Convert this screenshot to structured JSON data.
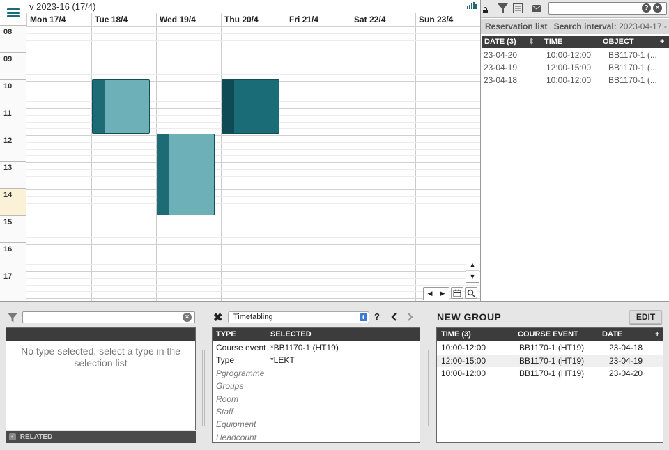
{
  "calendar": {
    "week_title": "v 2023-16 (17/4)",
    "days": [
      "Mon 17/4",
      "Tue 18/4",
      "Wed 19/4",
      "Thu 20/4",
      "Fri 21/4",
      "Sat 22/4",
      "Sun 23/4"
    ],
    "hours": [
      "08",
      "09",
      "10",
      "11",
      "12",
      "13",
      "14",
      "15",
      "16",
      "17"
    ],
    "highlight_hour": "14",
    "events": [
      {
        "day": 1,
        "start": 10,
        "end": 12,
        "style": "light"
      },
      {
        "day": 2,
        "start": 12,
        "end": 15,
        "style": "light"
      },
      {
        "day": 3,
        "start": 10,
        "end": 12,
        "style": "dark"
      }
    ],
    "colors": {
      "event_light": "#6db0b8",
      "event_dark": "#1a6c76",
      "accent": "#1e6b78"
    }
  },
  "right_panel": {
    "reservation_list_label": "Reservation list",
    "search_interval_label": "Search interval:",
    "search_interval_value": "2023-04-17 -",
    "search_value": "",
    "columns": [
      "DATE (3)",
      "TIME",
      "OBJECT"
    ],
    "add_label": "+",
    "rows": [
      {
        "date": "23-04-20",
        "time": "10:00-12:00",
        "object": "BB1170-1 (..."
      },
      {
        "date": "23-04-19",
        "time": "12:00-15:00",
        "object": "BB1170-1 (..."
      },
      {
        "date": "23-04-18",
        "time": "10:00-12:00",
        "object": "BB1170-1 (..."
      }
    ]
  },
  "bottom": {
    "left": {
      "filter_value": "",
      "empty_message": "No type selected, select a type in the selection list",
      "related_label": "RELATED"
    },
    "middle": {
      "dropdown_value": "Timetabling",
      "help_label": "?",
      "columns": [
        "TYPE",
        "SELECTED"
      ],
      "rows": [
        {
          "type": "Course event",
          "selected": "*BB1170-1 (HT19)",
          "italic": false
        },
        {
          "type": "Type",
          "selected": "*LEKT",
          "italic": false
        },
        {
          "type": "Pgrogramme",
          "selected": "",
          "italic": true
        },
        {
          "type": "Groups",
          "selected": "",
          "italic": true
        },
        {
          "type": "Room",
          "selected": "",
          "italic": true
        },
        {
          "type": "Staff",
          "selected": "",
          "italic": true
        },
        {
          "type": "Equipment",
          "selected": "",
          "italic": true
        },
        {
          "type": "Headcount",
          "selected": "",
          "italic": true
        }
      ]
    },
    "right": {
      "title": "NEW GROUP",
      "edit_label": "EDIT",
      "columns": [
        "TIME (3)",
        "COURSE EVENT",
        "DATE"
      ],
      "add_label": "+",
      "rows": [
        {
          "time": "10:00-12:00",
          "event": "BB1170-1 (HT19)",
          "date": "23-04-18"
        },
        {
          "time": "12:00-15:00",
          "event": "BB1170-1 (HT19)",
          "date": "23-04-19"
        },
        {
          "time": "10:00-12:00",
          "event": "BB1170-1 (HT19)",
          "date": "23-04-20"
        }
      ]
    }
  }
}
